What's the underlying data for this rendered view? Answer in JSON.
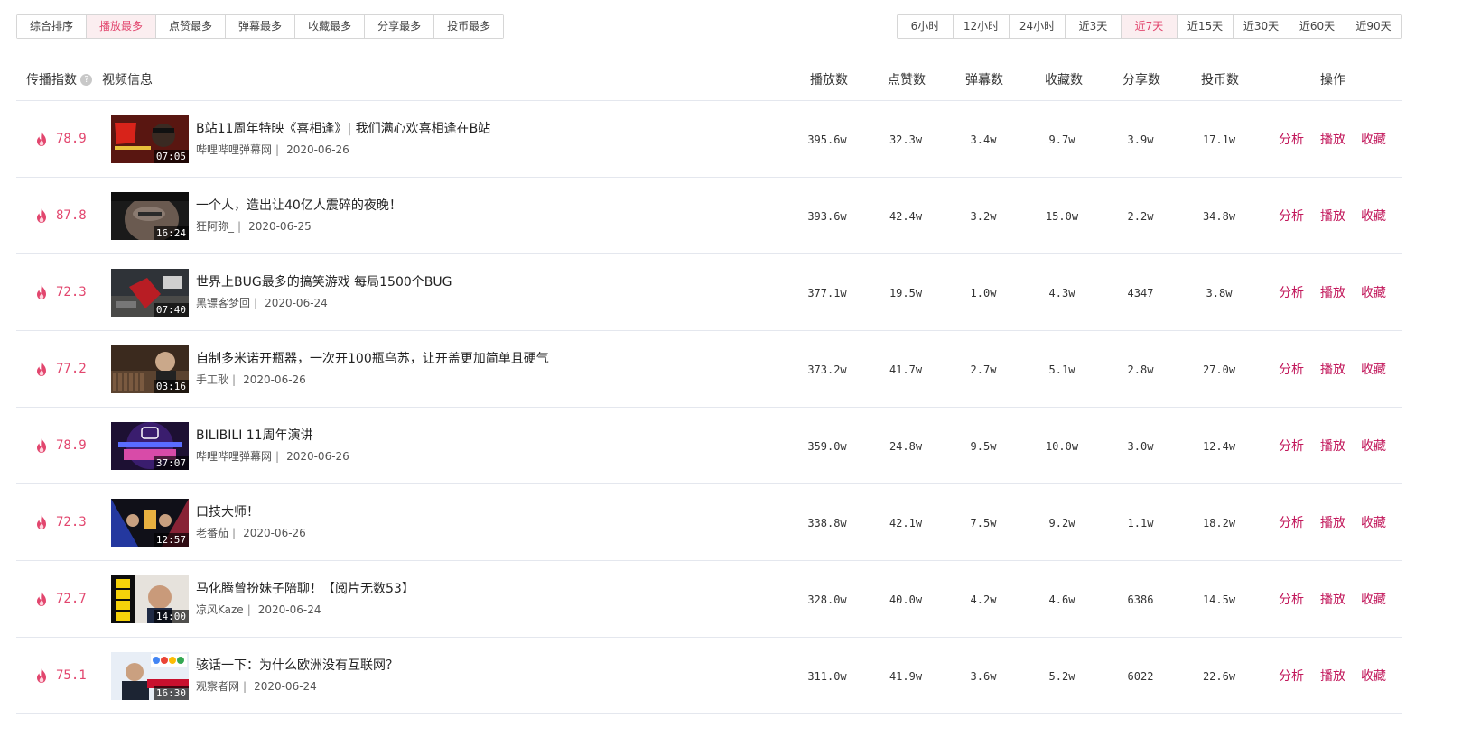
{
  "sort_tabs": [
    "综合排序",
    "播放最多",
    "点赞最多",
    "弹幕最多",
    "收藏最多",
    "分享最多",
    "投币最多"
  ],
  "time_tabs": [
    "6小时",
    "12小时",
    "24小时",
    "近3天",
    "近7天",
    "近15天",
    "近30天",
    "近60天",
    "近90天"
  ],
  "accent_color": "#e2466e",
  "headers": {
    "spread_index": "传播指数",
    "help_icon": "?",
    "video_info": "视频信息",
    "plays": "播放数",
    "likes": "点赞数",
    "danmaku": "弹幕数",
    "favorites": "收藏数",
    "shares": "分享数",
    "coins": "投币数",
    "actions": "操作"
  },
  "actions": {
    "analyze": "分析",
    "play": "播放",
    "favorite": "收藏"
  },
  "videos": [
    {
      "score": "78.9",
      "duration": "07:05",
      "title": "B站11周年特映《喜相逢》| 我们满心欢喜相逢在B站",
      "author": "哔哩哔哩弹幕网",
      "date": "2020-06-26",
      "plays": "395.6w",
      "likes": "32.3w",
      "danmaku": "3.4w",
      "favorites": "9.7w",
      "shares": "3.9w",
      "coins": "17.1w"
    },
    {
      "score": "87.8",
      "duration": "16:24",
      "title": "一个人，造出让40亿人震碎的夜晚！",
      "author": "狂阿弥_",
      "date": "2020-06-25",
      "plays": "393.6w",
      "likes": "42.4w",
      "danmaku": "3.2w",
      "favorites": "15.0w",
      "shares": "2.2w",
      "coins": "34.8w"
    },
    {
      "score": "72.3",
      "duration": "07:40",
      "title": "世界上BUG最多的搞笑游戏 每局1500个BUG",
      "author": "黑镖客梦回",
      "date": "2020-06-24",
      "plays": "377.1w",
      "likes": "19.5w",
      "danmaku": "1.0w",
      "favorites": "4.3w",
      "shares": "4347",
      "coins": "3.8w"
    },
    {
      "score": "77.2",
      "duration": "03:16",
      "title": "自制多米诺开瓶器，一次开100瓶乌苏，让开盖更加简单且硬气",
      "author": "手工耿",
      "date": "2020-06-26",
      "plays": "373.2w",
      "likes": "41.7w",
      "danmaku": "2.7w",
      "favorites": "5.1w",
      "shares": "2.8w",
      "coins": "27.0w"
    },
    {
      "score": "78.9",
      "duration": "37:07",
      "title": "BILIBILI 11周年演讲",
      "author": "哔哩哔哩弹幕网",
      "date": "2020-06-26",
      "plays": "359.0w",
      "likes": "24.8w",
      "danmaku": "9.5w",
      "favorites": "10.0w",
      "shares": "3.0w",
      "coins": "12.4w"
    },
    {
      "score": "72.3",
      "duration": "12:57",
      "title": "口技大师！",
      "author": "老番茄",
      "date": "2020-06-26",
      "plays": "338.8w",
      "likes": "42.1w",
      "danmaku": "7.5w",
      "favorites": "9.2w",
      "shares": "1.1w",
      "coins": "18.2w"
    },
    {
      "score": "72.7",
      "duration": "14:00",
      "title": "马化腾曾扮妹子陪聊！【阅片无数53】",
      "author": "凉风Kaze",
      "date": "2020-06-24",
      "plays": "328.0w",
      "likes": "40.0w",
      "danmaku": "4.2w",
      "favorites": "4.6w",
      "shares": "6386",
      "coins": "14.5w"
    },
    {
      "score": "75.1",
      "duration": "16:30",
      "title": "骇话一下：为什么欧洲没有互联网？",
      "author": "观察者网",
      "date": "2020-06-24",
      "plays": "311.0w",
      "likes": "41.9w",
      "danmaku": "3.6w",
      "favorites": "5.2w",
      "shares": "6022",
      "coins": "22.6w"
    }
  ]
}
